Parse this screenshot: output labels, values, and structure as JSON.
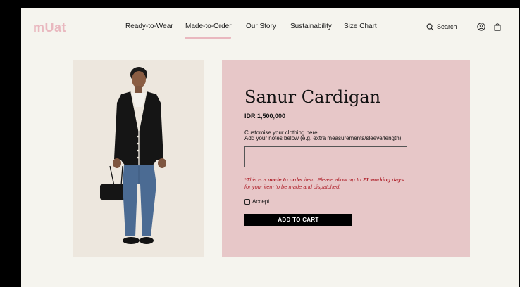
{
  "brand": {
    "logo": "mUat",
    "logo_color": "#e9b8bf"
  },
  "nav": {
    "items": [
      "Ready-to-Wear",
      "Made-to-Order",
      "Our Story",
      "Sustainability",
      "Size Chart"
    ],
    "active": "Made-to-Order",
    "search_label": "Search"
  },
  "icons": [
    "search-icon",
    "account-icon",
    "bag-icon"
  ],
  "product": {
    "title": "Sanur Cardigan",
    "price": "IDR 1,500,000",
    "customise_line1": "Customise your clothing here.",
    "customise_line2": "Add your notes below (e.g. extra measurements/sleeve/length)",
    "notes_value": "",
    "disclaimer": {
      "part1": "*This is a ",
      "bold1": "made to order",
      "part2": " item. Please allow ",
      "bold2": "up to 21 working days",
      "part3": " for your item to be made and dispatched."
    },
    "accept_label": "Accept",
    "accept_checked": false,
    "add_to_cart_label": "ADD TO CART"
  },
  "colors": {
    "panel": "#e7c7c8",
    "background": "#f5f4ee",
    "disclaimer": "#b0222c",
    "button": "#000000"
  }
}
